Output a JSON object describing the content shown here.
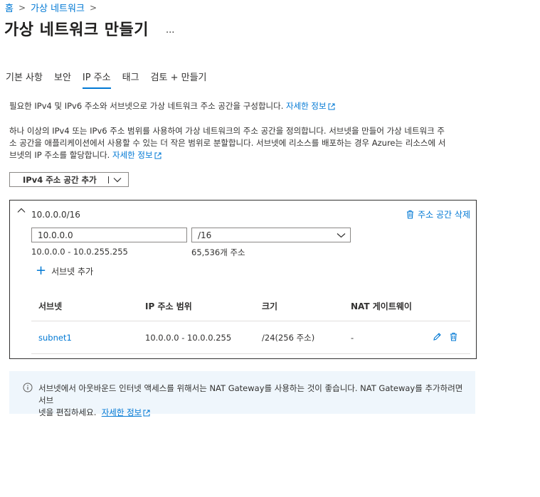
{
  "breadcrumb": {
    "items": [
      "홈",
      "가상 네트워크"
    ],
    "separator": ">"
  },
  "page": {
    "title": "가상 네트워크 만들기",
    "more_label": "..."
  },
  "tabs": [
    {
      "label": "기본 사항",
      "active": false
    },
    {
      "label": "보안",
      "active": false
    },
    {
      "label": "IP 주소",
      "active": true
    },
    {
      "label": "태그",
      "active": false
    },
    {
      "label": "검토 + 만들기",
      "active": false
    }
  ],
  "intro": {
    "line1_text": "필요한 IPv4 및 IPv6 주소와 서브넷으로 가상 네트워크 주소 공간을 구성합니다.",
    "line1_link": "자세한 정보",
    "line2_text_a": "하나 이상의 IPv4 또는 IPv6 주소 범위를 사용하여 가상 네트워크의 주소 공간을 정의합니다. 서브넷을 만들어 가상 네트워크 주",
    "line2_text_b": "소 공간을 애플리케이션에서 사용할 수 있는 더 작은 범위로 분할합니다. 서브넷에 리소스를 배포하는 경우 Azure는 리소스에 서",
    "line2_text_c": "브넷의 IP 주소를 할당합니다.",
    "line2_link": "자세한 정보"
  },
  "add_space_button": {
    "label": "IPv4 주소 공간 추가"
  },
  "address_space": {
    "title": "10.0.0.0/16",
    "delete_label": "주소 공간 삭제",
    "ip_value": "10.0.0.0",
    "mask_value": "/16",
    "range": "10.0.0.0 - 10.0.255.255",
    "count": "65,536개 주소",
    "add_subnet_label": "서브넷 추가"
  },
  "subnet_table": {
    "headers": [
      "서브넷",
      "IP 주소 범위",
      "크기",
      "NAT 게이트웨이"
    ],
    "rows": [
      {
        "name": "subnet1",
        "range": "10.0.0.0 - 10.0.0.255",
        "size": "/24(256 주소)",
        "nat": "-"
      }
    ]
  },
  "info_bar": {
    "text_a": "서브넷에서 아웃바운드 인터넷 액세스를 위해서는 NAT Gateway를 사용하는 것이 좋습니다. NAT Gateway를 추가하려면 서브",
    "text_b": "넷을 편집하세요.",
    "link": "자세한 정보"
  },
  "colors": {
    "accent": "#0078d4",
    "info_bg": "#eff6fc",
    "text": "#323130"
  }
}
